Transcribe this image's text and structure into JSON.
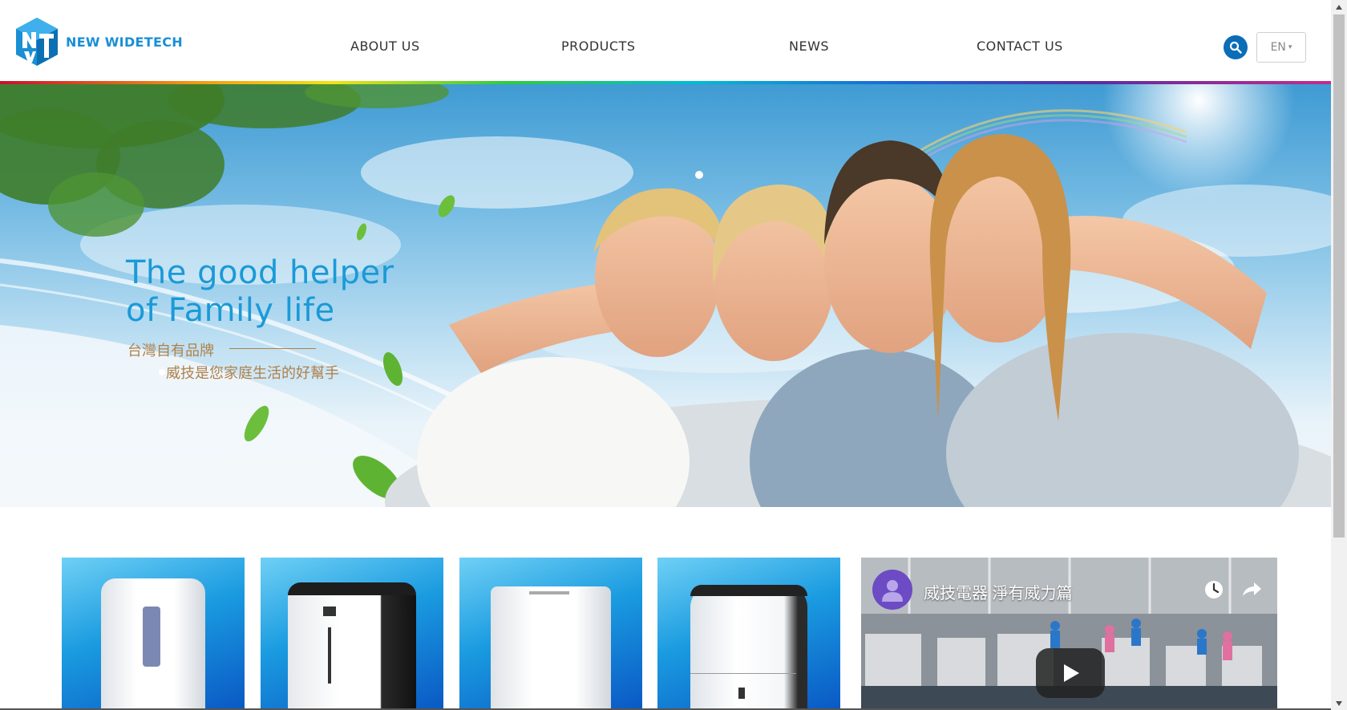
{
  "brand": {
    "name": "NEW WIDETECH"
  },
  "nav": {
    "items": [
      {
        "label": "ABOUT  US",
        "icon": ""
      },
      {
        "label": "PRODUCTS"
      },
      {
        "label": "NEWS"
      },
      {
        "label": "CONTACT  US"
      }
    ],
    "search_icon": "search-icon",
    "language": {
      "selected": "EN",
      "caret": "▾"
    }
  },
  "hero": {
    "title_line1": "The good helper",
    "title_line2": "of Family life",
    "subtitle_line1": "台灣自有品牌",
    "subtitle_line2": "威技是您家庭生活的好幫手"
  },
  "products": [
    {
      "name": "portable-air-conditioner"
    },
    {
      "name": "portable-air-conditioner-dark"
    },
    {
      "name": "dehumidifier-white"
    },
    {
      "name": "dehumidifier-tank"
    }
  ],
  "video": {
    "title": "威技電器 淨有威力篇",
    "clock_icon": "clock-icon",
    "share_icon": "share-icon",
    "play_icon": "play-icon"
  },
  "colors": {
    "brand_blue": "#1a8fd4",
    "search_blue": "#0a6db8",
    "hero_title": "#1a9ad7",
    "hero_subtitle": "#b0804a"
  }
}
